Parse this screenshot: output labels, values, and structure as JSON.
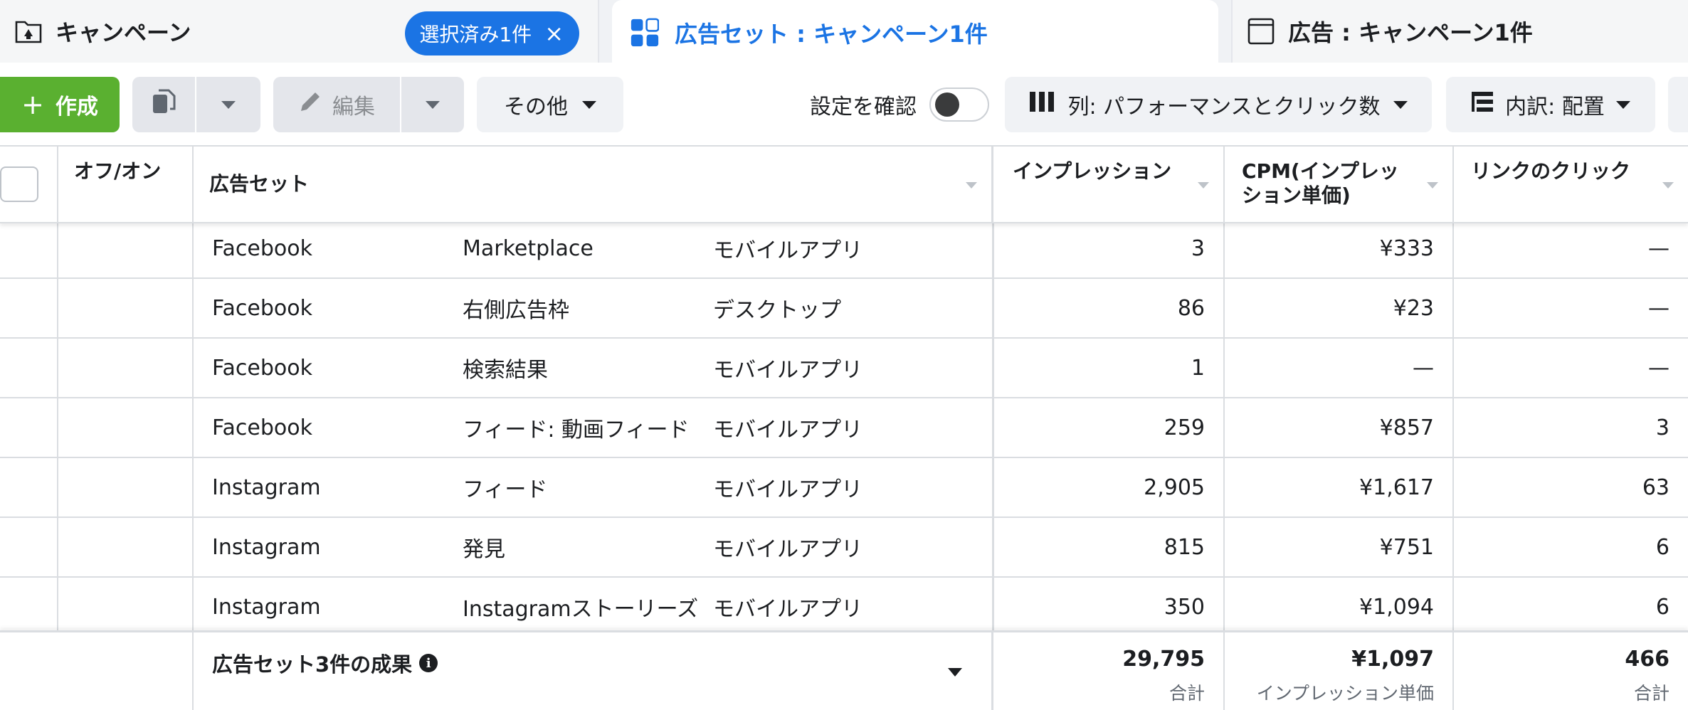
{
  "tabs": {
    "campaign": {
      "label": "キャンペーン",
      "icon": "folder-icon"
    },
    "selected_chip": {
      "label": "選択済み1件",
      "close": "×"
    },
    "adsets": {
      "label": "広告セット : キャンペーン1件",
      "icon": "grid-icon"
    },
    "ads": {
      "label": "広告 : キャンペーン1件",
      "icon": "ad-window-icon"
    }
  },
  "toolbar": {
    "create_label": "作成",
    "create_plus": "+",
    "edit_label": "編集",
    "other_label": "その他",
    "verify_label": "設定を確認",
    "columns_label": "列: パフォーマンスとクリック数",
    "breakdown_label": "内訳: 配置",
    "accent_color": "#5ab030",
    "primary_color": "#1b74e4"
  },
  "table": {
    "headers": {
      "onoff": "オフ/オン",
      "adset": "広告セット",
      "impressions": "インプレッション",
      "cpm": "CPM(インプレッション単価)",
      "link_clicks": "リンクのクリック"
    },
    "rows": [
      {
        "platform": "Facebook",
        "position": "Marketplace",
        "device": "モバイルアプリ",
        "impressions": "3",
        "cpm": "¥333",
        "clicks": "—"
      },
      {
        "platform": "Facebook",
        "position": "右側広告枠",
        "device": "デスクトップ",
        "impressions": "86",
        "cpm": "¥23",
        "clicks": "—"
      },
      {
        "platform": "Facebook",
        "position": "検索結果",
        "device": "モバイルアプリ",
        "impressions": "1",
        "cpm": "—",
        "clicks": "—"
      },
      {
        "platform": "Facebook",
        "position": "フィード: 動画フィード",
        "device": "モバイルアプリ",
        "impressions": "259",
        "cpm": "¥857",
        "clicks": "3"
      },
      {
        "platform": "Instagram",
        "position": "フィード",
        "device": "モバイルアプリ",
        "impressions": "2,905",
        "cpm": "¥1,617",
        "clicks": "63"
      },
      {
        "platform": "Instagram",
        "position": "発見",
        "device": "モバイルアプリ",
        "impressions": "815",
        "cpm": "¥751",
        "clicks": "6"
      },
      {
        "platform": "Instagram",
        "position": "Instagramストーリーズ",
        "device": "モバイルアプリ",
        "impressions": "350",
        "cpm": "¥1,094",
        "clicks": "6"
      }
    ],
    "footer": {
      "title": "広告セット3件の成果",
      "info": "i",
      "impressions": {
        "value": "29,795",
        "label": "合計"
      },
      "cpm": {
        "value": "¥1,097",
        "label": "インプレッション単価"
      },
      "clicks": {
        "value": "466",
        "label": "合計"
      }
    }
  }
}
